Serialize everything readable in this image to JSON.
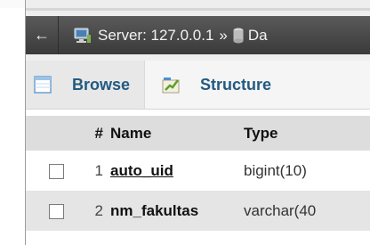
{
  "breadcrumb": {
    "back_glyph": "←",
    "server_text": "Server: 127.0.0.1",
    "separator": "»",
    "db_text": "Da",
    "server_icon": "server-icon",
    "db_icon": "database-icon"
  },
  "tabs": [
    {
      "label": "Browse",
      "icon": "browse-table-icon"
    },
    {
      "label": "Structure",
      "icon": "structure-icon"
    }
  ],
  "table": {
    "headers": {
      "num": "#",
      "name": "Name",
      "type": "Type"
    },
    "rows": [
      {
        "num": "1",
        "name": "auto_uid",
        "type": "bigint(10)"
      },
      {
        "num": "2",
        "name": "nm_fakultas",
        "type": "varchar(40"
      }
    ]
  },
  "colors": {
    "breadcrumb_bg": "#4a4a4a",
    "tab_text": "#235a81",
    "header_bg": "#dddddd",
    "row_even_bg": "#e5e5e5"
  }
}
